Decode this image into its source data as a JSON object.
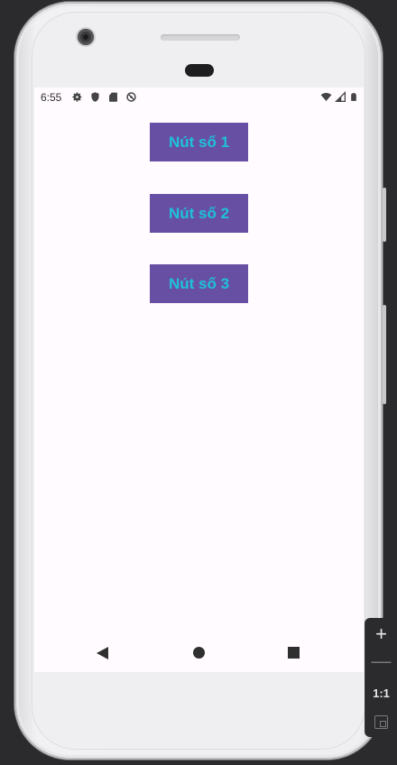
{
  "status_bar": {
    "time": "6:55",
    "left_icons": [
      "gear-icon",
      "shield-icon",
      "sd-card-icon",
      "no-sync-icon"
    ],
    "right_icons": [
      "wifi-icon",
      "signal-icon",
      "battery-icon"
    ]
  },
  "buttons": [
    {
      "label": "Nút số 1"
    },
    {
      "label": "Nút số 2"
    },
    {
      "label": "Nút số 3"
    }
  ],
  "colors": {
    "button_background": "#6750a4",
    "button_text": "#1fc1da",
    "screen_background": "#fffbfe"
  },
  "nav_bar": {
    "icons": [
      "back-icon",
      "home-icon",
      "recents-icon"
    ]
  },
  "zoom_toolbar": {
    "zoom_in": "+",
    "zoom_out": "—",
    "actual_size": "1:1",
    "fit_icon": "fit-to-window-icon"
  }
}
